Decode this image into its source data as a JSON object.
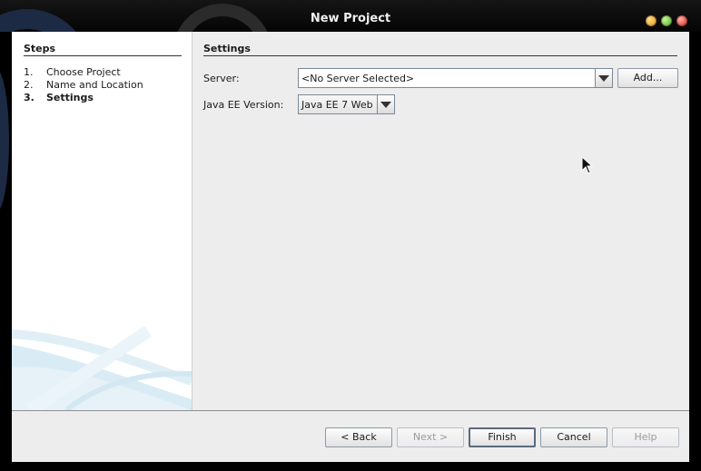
{
  "window": {
    "title": "New Project"
  },
  "steps": {
    "heading": "Steps",
    "items": [
      {
        "num": "1.",
        "label": "Choose Project"
      },
      {
        "num": "2.",
        "label": "Name and Location"
      },
      {
        "num": "3.",
        "label": "Settings"
      }
    ],
    "current_index": 2
  },
  "settings": {
    "heading": "Settings",
    "server_label": "Server:",
    "server_value": "<No Server Selected>",
    "add_label": "Add...",
    "javaee_label": "Java EE Version:",
    "javaee_value": "Java EE 7 Web"
  },
  "footer": {
    "back_label": "< Back",
    "next_label": "Next >",
    "finish_label": "Finish",
    "cancel_label": "Cancel",
    "help_label": "Help"
  },
  "colors": {
    "dialog_bg": "#ededed",
    "titlebar_bg": "#0a0a0a",
    "close_button": "#d11f14",
    "maximize_button": "#4aa31a",
    "minimize_button": "#e38a12"
  },
  "icons": [
    "minimize-icon",
    "maximize-icon",
    "close-icon",
    "chevron-down-icon",
    "mouse-pointer-icon"
  ]
}
